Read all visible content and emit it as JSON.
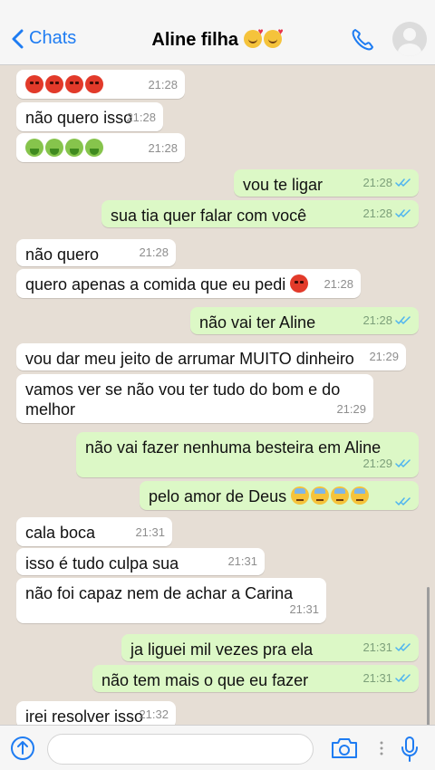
{
  "header": {
    "back_label": "Chats",
    "title": "Aline filha",
    "title_emojis": [
      "smiling-face-with-hearts",
      "smiling-face-with-hearts"
    ]
  },
  "messages": [
    {
      "dir": "in",
      "emoji": [
        "angry",
        "angry",
        "angry",
        "angry"
      ],
      "text": "",
      "time": "21:28"
    },
    {
      "dir": "in",
      "emoji": [],
      "text": "não quero isso",
      "time": "21:28"
    },
    {
      "dir": "in",
      "emoji": [
        "sick",
        "sick",
        "sick",
        "sick"
      ],
      "text": "",
      "time": "21:28"
    },
    {
      "dir": "out",
      "emoji": [],
      "text": "vou te ligar",
      "time": "21:28"
    },
    {
      "dir": "out",
      "emoji": [],
      "text": "sua tia quer falar com você",
      "time": "21:28"
    },
    {
      "dir": "in",
      "emoji": [],
      "text": "não quero",
      "time": "21:28"
    },
    {
      "dir": "in",
      "emoji": [
        "angry"
      ],
      "text": "quero apenas a comida que eu pedi",
      "time": "21:28"
    },
    {
      "dir": "out",
      "emoji": [],
      "text": "não vai ter Aline",
      "time": "21:28"
    },
    {
      "dir": "in",
      "emoji": [],
      "text": "vou dar meu jeito de arrumar MUITO dinheiro",
      "time": "21:29"
    },
    {
      "dir": "in",
      "emoji": [],
      "text": "vamos ver se não vou ter tudo do bom e do melhor",
      "time": "21:29"
    },
    {
      "dir": "out",
      "emoji": [],
      "text": "não vai fazer nenhuma besteira em Aline",
      "time": "21:29"
    },
    {
      "dir": "out",
      "emoji": [
        "tired",
        "tired",
        "tired",
        "tired"
      ],
      "text": "pelo amor de Deus",
      "time": ""
    },
    {
      "dir": "in",
      "emoji": [],
      "text": "cala boca",
      "time": "21:31"
    },
    {
      "dir": "in",
      "emoji": [],
      "text": "isso é tudo culpa sua",
      "time": "21:31"
    },
    {
      "dir": "in",
      "emoji": [],
      "text": "não foi capaz nem de achar a Carina",
      "time": "21:31"
    },
    {
      "dir": "out",
      "emoji": [],
      "text": "ja liguei mil vezes pra ela",
      "time": "21:31"
    },
    {
      "dir": "out",
      "emoji": [],
      "text": "não tem mais o que eu fazer",
      "time": "21:31"
    },
    {
      "dir": "in",
      "emoji": [],
      "text": "irei resolver isso",
      "time": "21:32"
    }
  ],
  "footer": {
    "input_value": "",
    "icons": [
      "upload-icon",
      "camera-icon",
      "microphone-icon"
    ]
  },
  "colors": {
    "accent": "#1e7cf2",
    "incoming": "#ffffff",
    "outgoing": "#dcf8c6",
    "background": "#e6ded5",
    "read_ticks": "#4fb4f0"
  }
}
